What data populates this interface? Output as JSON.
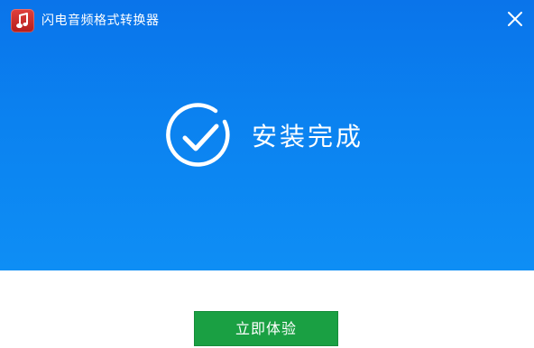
{
  "window": {
    "title": "闪电音频格式转换器",
    "icons": {
      "logo": "music-note-icon",
      "close": "close-icon",
      "status": "check-circle-icon"
    }
  },
  "main": {
    "status_text": "安装完成",
    "primary_button_label": "立即体验"
  },
  "colors": {
    "banner": "#0b82f0",
    "button": "#1aa043",
    "logo": "#c9302c",
    "text_on_banner": "#ffffff"
  }
}
